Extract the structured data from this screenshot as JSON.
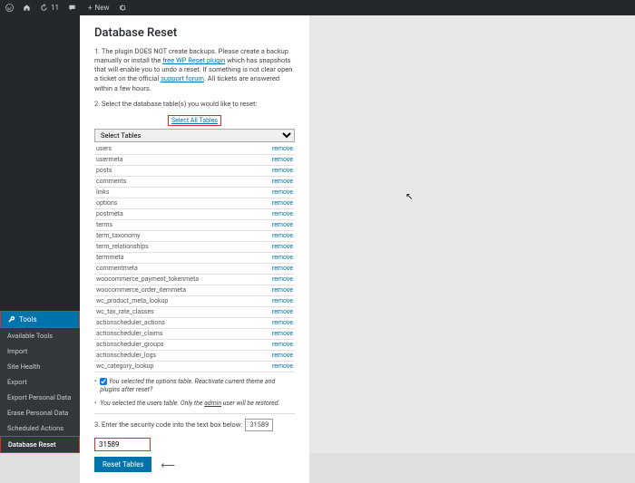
{
  "adminbar": {
    "updates_count": "11",
    "comments_count": "",
    "new_label": "New"
  },
  "sidebar": {
    "tools_label": "Tools",
    "items": [
      {
        "label": "Available Tools"
      },
      {
        "label": "Import"
      },
      {
        "label": "Site Health"
      },
      {
        "label": "Export"
      },
      {
        "label": "Export Personal Data"
      },
      {
        "label": "Erase Personal Data"
      },
      {
        "label": "Scheduled Actions"
      },
      {
        "label": "Database Reset"
      }
    ]
  },
  "page": {
    "title": "Database Reset",
    "step1_a": "1. The plugin DOES NOT create backups. Please create a backup manually or install the ",
    "step1_link": "free WP Reset plugin",
    "step1_b": " which has snapshots that will enable you to undo a reset. If something is not clear open a ticket on the official ",
    "step1_link2": "support forum",
    "step1_c": ". All tickets are answered within a few hours.",
    "step2": "2. Select the database table(s) you would like to reset:",
    "select_all": "Select All Tables",
    "select_placeholder": "Select Tables",
    "tables": [
      "users",
      "usermeta",
      "posts",
      "comments",
      "links",
      "options",
      "postmeta",
      "terms",
      "term_taxonomy",
      "term_relationships",
      "termmeta",
      "commentmeta",
      "woocommerce_payment_tokenmeta",
      "woocommerce_order_itemmeta",
      "wc_product_meta_lookup",
      "wc_tax_rate_classes",
      "actionscheduler_actions",
      "actionscheduler_claims",
      "actionscheduler_groups",
      "actionscheduler_logs",
      "wc_category_lookup"
    ],
    "remove_label": "remove",
    "note1_a": "You selected the options table. Reactivate current theme and plugins after reset?",
    "note2_a": "You selected the users table. Only the ",
    "note2_admin": "admin",
    "note2_b": " user will be restored.",
    "step3": "3. Enter the security code into the text box below:",
    "security_code": "31589",
    "input_value": "31589",
    "reset_button": "Reset Tables"
  }
}
